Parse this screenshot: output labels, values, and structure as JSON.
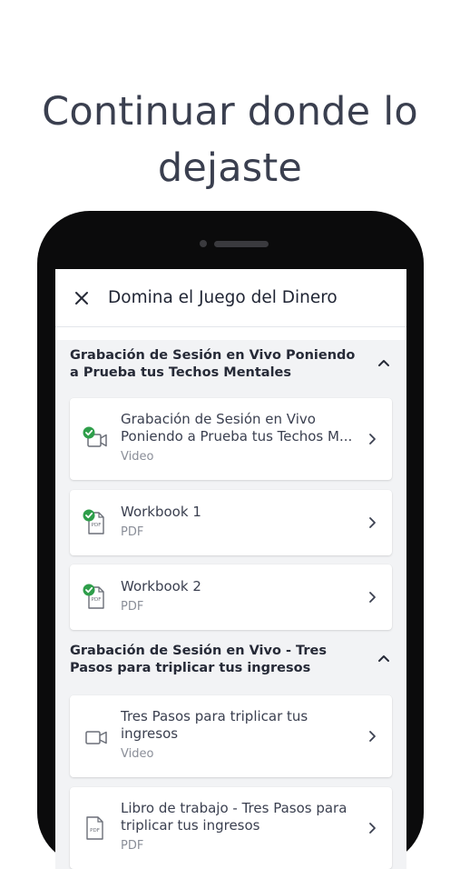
{
  "headline": {
    "line1": "Continuar donde lo",
    "line2": "dejaste"
  },
  "topbar": {
    "title": "Domina el Juego del Dinero",
    "close_icon": "close-icon"
  },
  "sections": [
    {
      "title": "Grabación de Sesión en Vivo Poniendo a Prueba tus Techos Mentales",
      "expanded": true,
      "items": [
        {
          "title": "Grabación de Sesión en Vivo Poniendo a Prueba tus Techos M...",
          "type": "Video",
          "icon": "video-icon",
          "completed": true
        },
        {
          "title": "Workbook 1",
          "type": "PDF",
          "icon": "pdf-icon",
          "completed": true
        },
        {
          "title": "Workbook 2",
          "type": "PDF",
          "icon": "pdf-icon",
          "completed": true
        }
      ]
    },
    {
      "title": "Grabación de Sesión en Vivo - Tres Pasos para triplicar tus ingresos",
      "expanded": true,
      "items": [
        {
          "title": "Tres Pasos para triplicar tus ingresos",
          "type": "Video",
          "icon": "video-icon",
          "completed": false
        },
        {
          "title": "Libro de trabajo - Tres Pasos para triplicar tus ingresos",
          "type": "PDF",
          "icon": "pdf-icon",
          "completed": false
        }
      ]
    }
  ],
  "colors": {
    "check": "#2e9e4a",
    "text": "#2b2f3f",
    "muted": "#8a8e98",
    "phone": "#0b0b0c"
  }
}
